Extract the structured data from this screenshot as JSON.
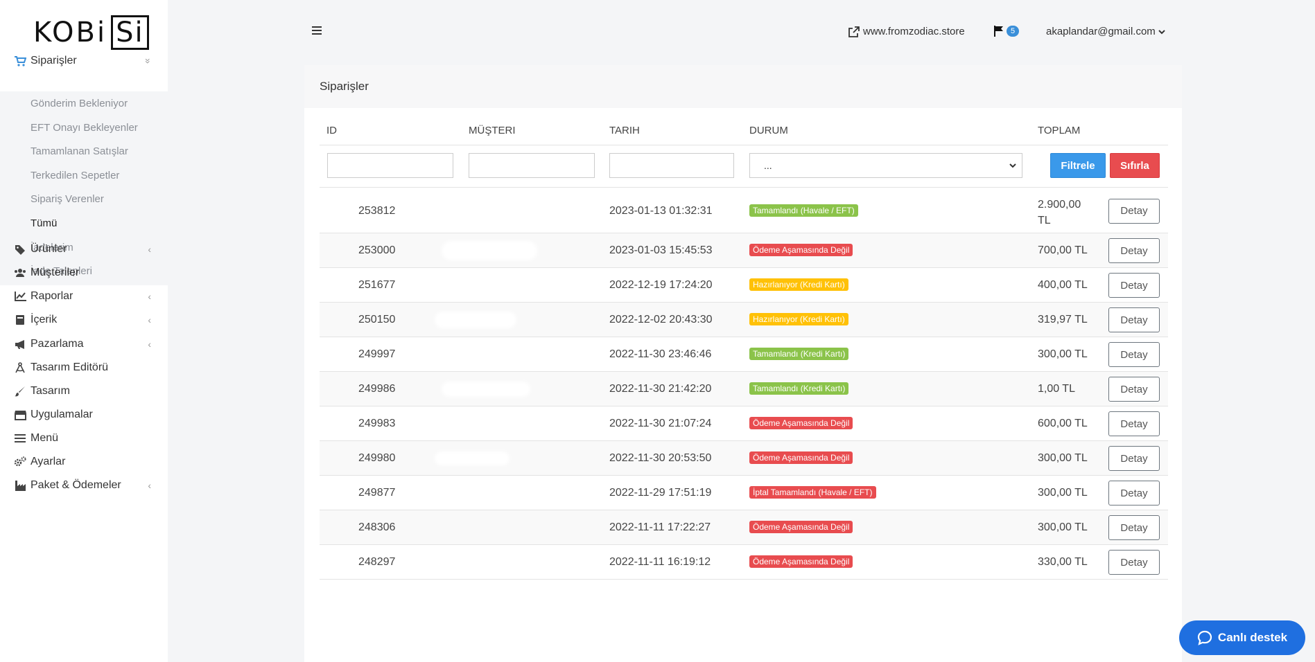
{
  "logo": {
    "part1": "KOBi",
    "part2": "Si"
  },
  "sidebar": {
    "items": [
      {
        "label": "Siparişler",
        "icon": "cart-icon",
        "has_arrow": true,
        "arrow": "»"
      },
      {
        "label": "Ürünler",
        "icon": "tags-icon",
        "has_arrow": true,
        "arrow": "‹"
      },
      {
        "label": "Müşteriler",
        "icon": "users-icon",
        "has_arrow": false,
        "arrow": ""
      },
      {
        "label": "Raporlar",
        "icon": "chart-line-icon",
        "has_arrow": true,
        "arrow": "‹"
      },
      {
        "label": "İçerik",
        "icon": "book-icon",
        "has_arrow": true,
        "arrow": "‹"
      },
      {
        "label": "Pazarlama",
        "icon": "megaphone-icon",
        "has_arrow": true,
        "arrow": "‹"
      },
      {
        "label": "Tasarım Editörü",
        "icon": "drafting-compass-icon",
        "has_arrow": false,
        "arrow": ""
      },
      {
        "label": "Tasarım",
        "icon": "brush-icon",
        "has_arrow": false,
        "arrow": ""
      },
      {
        "label": "Uygulamalar",
        "icon": "store-icon",
        "has_arrow": false,
        "arrow": ""
      },
      {
        "label": "Menü",
        "icon": "bars-icon",
        "has_arrow": false,
        "arrow": ""
      },
      {
        "label": "Ayarlar",
        "icon": "cogs-icon",
        "has_arrow": false,
        "arrow": ""
      },
      {
        "label": "Paket & Ödemeler",
        "icon": "industry-icon",
        "has_arrow": true,
        "arrow": "‹"
      }
    ],
    "subitems": [
      "Gönderim Bekleniyor",
      "EFT Onayı Bekleyenler",
      "Tamamlanan Satışlar",
      "Terkedilen Sepetler",
      "Sipariş Verenler",
      "Tümü",
      "İadelerim",
      "İade Talepleri"
    ]
  },
  "topbar": {
    "store": "www.fromzodiac.store",
    "flag_count": "5",
    "user": "akaplandar@gmail.com"
  },
  "card": {
    "title": "Siparişler"
  },
  "table": {
    "headers": {
      "id": "ID",
      "customer": "MÜŞTERI",
      "date": "TARIH",
      "status": "DURUM",
      "total": "TOPLAM"
    },
    "filter": {
      "select_value": "...",
      "filter_button": "Filtrele",
      "reset_button": "Sıfırla"
    },
    "detail_label": "Detay",
    "rows": [
      {
        "id": "253812",
        "date": "2023-01-13 01:32:31",
        "status": "Tamamlandı (Havale / EFT)",
        "status_color": "#8bc34a",
        "total": "2.900,00 TL"
      },
      {
        "id": "253000",
        "date": "2023-01-03 15:45:53",
        "status": "Ödeme Aşamasında Değil",
        "status_color": "#e84c4f",
        "total": "700,00 TL"
      },
      {
        "id": "251677",
        "date": "2022-12-19 17:24:20",
        "status": "Hazırlanıyor (Kredi Kartı)",
        "status_color": "#ffc107",
        "total": "400,00 TL"
      },
      {
        "id": "250150",
        "date": "2022-12-02 20:43:30",
        "status": "Hazırlanıyor (Kredi Kartı)",
        "status_color": "#ffc107",
        "total": "319,97 TL"
      },
      {
        "id": "249997",
        "date": "2022-11-30 23:46:46",
        "status": "Tamamlandı (Kredi Kartı)",
        "status_color": "#8bc34a",
        "total": "300,00 TL"
      },
      {
        "id": "249986",
        "date": "2022-11-30 21:42:20",
        "status": "Tamamlandı (Kredi Kartı)",
        "status_color": "#8bc34a",
        "total": "1,00 TL"
      },
      {
        "id": "249983",
        "date": "2022-11-30 21:07:24",
        "status": "Ödeme Aşamasında Değil",
        "status_color": "#e84c4f",
        "total": "600,00 TL"
      },
      {
        "id": "249980",
        "date": "2022-11-30 20:53:50",
        "status": "Ödeme Aşamasında Değil",
        "status_color": "#e84c4f",
        "total": "300,00 TL"
      },
      {
        "id": "249877",
        "date": "2022-11-29 17:51:19",
        "status": "İptal Tamamlandı (Havale / EFT)",
        "status_color": "#e84c4f",
        "total": "300,00 TL"
      },
      {
        "id": "248306",
        "date": "2022-11-11 17:22:27",
        "status": "Ödeme Aşamasında Değil",
        "status_color": "#e84c4f",
        "total": "300,00 TL"
      },
      {
        "id": "248297",
        "date": "2022-11-11 16:19:12",
        "status": "Ödeme Aşamasında Değil",
        "status_color": "#e84c4f",
        "total": "330,00 TL"
      }
    ]
  },
  "chat": {
    "label": "Canlı destek"
  }
}
